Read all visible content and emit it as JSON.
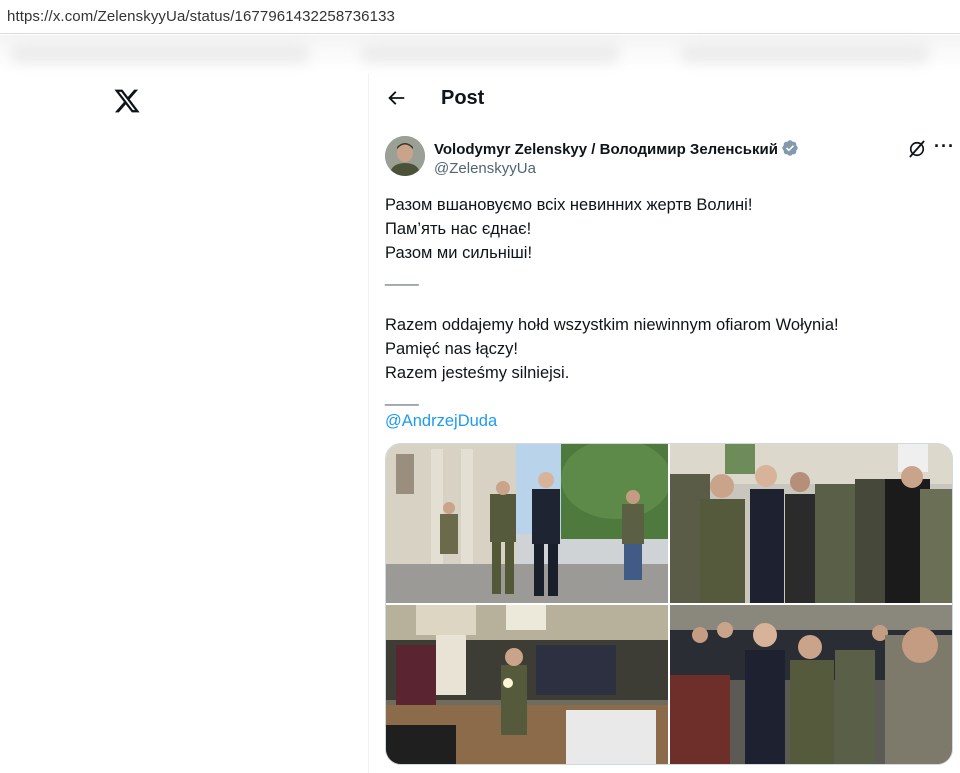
{
  "browser": {
    "url": "https://x.com/ZelenskyyUa/status/1677961432258736133"
  },
  "sidebar": {
    "logo_icon": "x-logo-icon"
  },
  "header": {
    "back_icon": "arrow-left-icon",
    "title": "Post"
  },
  "post": {
    "author_name": "Volodymyr Zelenskyy / Володимир Зеленський",
    "author_handle": "@ZelenskyyUa",
    "verified_icon": "verified-badge-icon",
    "verified_color": "#829aab",
    "grok_icon": "grok-icon",
    "more_icon": "more-icon",
    "more_label": "···",
    "lines_ua": [
      "Разом вшановуємо всіх невинних жертв Волині!",
      "Пам’ять нас єднає!",
      "Разом ми сильніші!"
    ],
    "separator_1": "____",
    "lines_pl": [
      "Razem oddajemy hołd wszystkim niewinnym ofiarom Wołynia!",
      "Pamięć nas łączy!",
      "Razem jesteśmy silniejsi."
    ],
    "separator_2": "____",
    "mention": "@AndrzejDuda",
    "mention_color": "#1d9bf0",
    "media_count": 4
  }
}
